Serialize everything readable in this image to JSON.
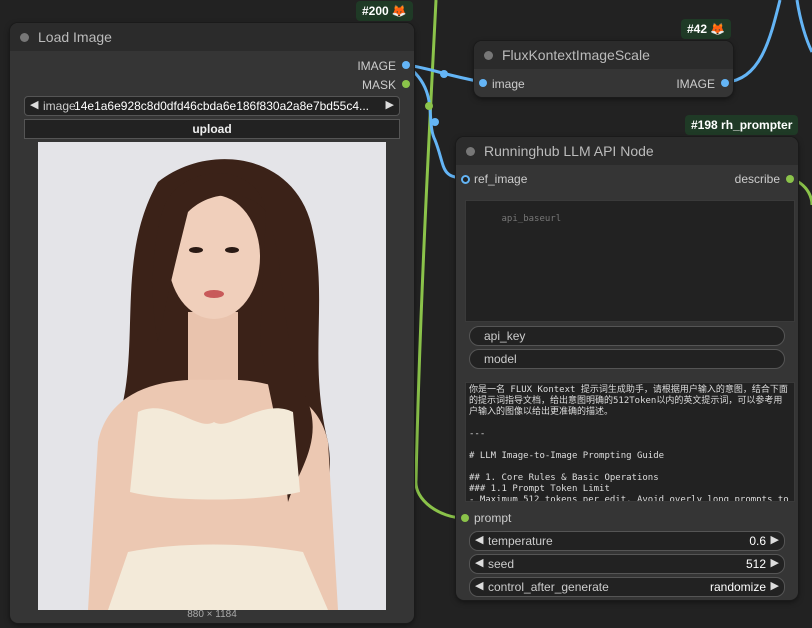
{
  "nodes": {
    "load_image": {
      "badge": "#200",
      "title": "Load Image",
      "outputs": [
        "IMAGE",
        "MASK"
      ],
      "image_widget_label": "image",
      "image_widget_value": "14e1a6e928c8d0dfd46cbda6e186f830a2a8e7bd55c4...",
      "upload_label": "upload",
      "image_size": "880 × 1184"
    },
    "flux_scale": {
      "badge": "#42",
      "title": "FluxKontextImageScale",
      "input": "image",
      "output": "IMAGE"
    },
    "llm_node": {
      "badge": "#198 rh_prompter",
      "title": "Runninghub LLM API Node",
      "input": "ref_image",
      "output": "describe",
      "api_baseurl_placeholder": "api_baseurl",
      "api_key_label": "api_key",
      "model_label": "model",
      "prompt_text": "你是一名 FLUX Kontext 提示词生成助手，请根据用户输入的意图，结合下面的提示词指导文档，给出意图明确的512Token以内的英文提示词，可以参考用户输入的图像以给出更准确的描述。\n\n---\n\n# LLM Image-to-Image Prompting Guide\n\n## 1. Core Rules & Basic Operations\n### 1.1 Prompt Token Limit\n- Maximum 512 tokens per edit. Avoid overly long prompts to prevent key information loss.",
      "prompt_input": "prompt",
      "temperature_label": "temperature",
      "temperature_value": "0.6",
      "seed_label": "seed",
      "seed_value": "512",
      "control_label": "control_after_generate",
      "control_value": "randomize"
    }
  },
  "icons": {
    "fox": "fox-icon",
    "left_arrow": "◀",
    "right_arrow": "▶"
  },
  "colors": {
    "link_blue": "#64b5f6",
    "link_green": "#8bc34a",
    "badge_bg": "#1f3a26",
    "fox": "#e8732a"
  }
}
